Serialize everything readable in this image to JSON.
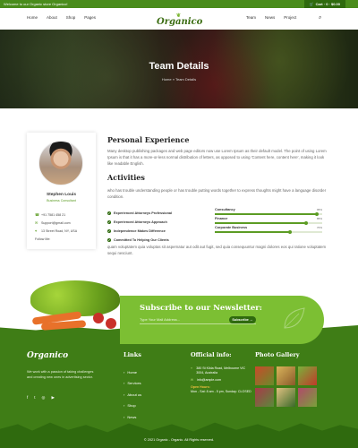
{
  "topbar": {
    "welcome": "Welcome to our Organic store Organico!",
    "cart": "Cart · 0 · $0.00"
  },
  "nav": {
    "left_items": [
      "Home",
      "About",
      "Shop",
      "Pages"
    ],
    "right_items": [
      "Team",
      "News",
      "Project"
    ],
    "logo": "Organico"
  },
  "hero": {
    "title": "Team Details",
    "crumb_home": "Home",
    "crumb_sep": "»",
    "crumb_current": "Team Details"
  },
  "profile": {
    "name": "Stephen Louis",
    "role": "Business Consultant",
    "phone": "+91 7581 458 21",
    "email": "Support@gmail.com",
    "address": "13 Street Road, NY, USA",
    "follow": "Follow Me:"
  },
  "experience": {
    "heading": "Personal Experience",
    "text": "Many desktop publishing packages and web page editors now use Lorem Ipsum as their default model. The point of using Lorem Ipsum is that it has a more-or-less normal distribution of letters, as opposed to using 'Content here, content here', making it look like readable English."
  },
  "activities": {
    "heading": "Activities",
    "text": "who has trouble understanding people or has trouble putting words together to express thoughts might have a language disorder condition.",
    "checks": [
      "Experienced Attorneys Professional",
      "Experienced Attorneys Approach",
      "Independence Makes Difference",
      "Committed To Helping Our Clients"
    ],
    "skills": [
      {
        "label": "Consultancy",
        "value": 95,
        "pct": "95%"
      },
      {
        "label": "Finance",
        "value": 85,
        "pct": "85%"
      },
      {
        "label": "Corporate Business",
        "value": 70,
        "pct": "70%"
      }
    ],
    "closing": "quam voluptatem quia voluptas sit aspernatur aut odit aut fugit, sed quia consequuntur magni dolores eos qui ratione voluptatem sequi nesciunt."
  },
  "newsletter": {
    "title": "Subscribe to our Newsletter:",
    "placeholder": "Type Your Mail Address...",
    "button": "Subscribe →"
  },
  "footer": {
    "logo": "Organico",
    "about": "We work with a passion of taking challenges and creating new ones in advertising sector.",
    "links_heading": "Links",
    "links": [
      "Home",
      "Services",
      "About us",
      "Shop",
      "News"
    ],
    "info_heading": "Official info:",
    "address": "380 St Kilda Road, Melbourne VIC 3004, Australia",
    "email": "info@ample.com",
    "hours_label": "Open Hours:",
    "hours": "Mon - Sat: 8 am - 5 pm, Sunday: CLOSED",
    "gallery_heading": "Photo Gallery",
    "copyright": "© 2021 Organic - Organic. All Rights reserved."
  },
  "colors": {
    "primary": "#4a8c1c",
    "accent": "#7cbf33",
    "dark": "#2f6a0e"
  }
}
